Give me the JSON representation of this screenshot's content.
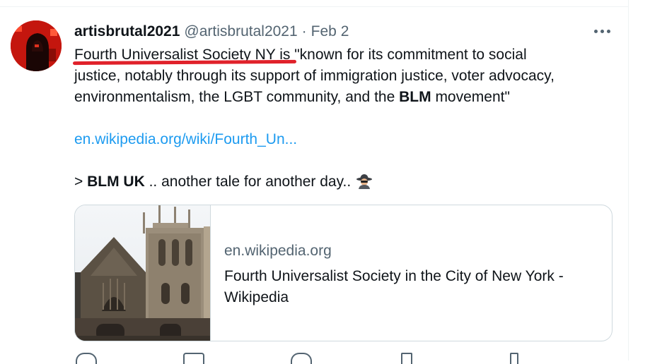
{
  "tweet": {
    "display_name": "artisbrutal2021",
    "handle": "@artisbrutal2021",
    "separator": "·",
    "date": "Feb 2",
    "body": {
      "line1_link": "Fourth Universalist Society NY",
      "line1_rest": " is \"known for its commitment to social",
      "line2": "justice, notably through its support of immigration justice, voter advocacy,",
      "line3_a": "environmentalism, the LGBT community, and the ",
      "line3_bold": "BLM",
      "line3_b": " movement\"",
      "url": "en.wikipedia.org/wiki/Fourth_Un...",
      "line6_prefix": "> ",
      "line6_bold": "BLM UK",
      "line6_rest": " .. another tale for another day.."
    }
  },
  "card": {
    "domain": "en.wikipedia.org",
    "title_line1": "Fourth Universalist Society in the City of New York -",
    "title_line2": "Wikipedia"
  },
  "colors": {
    "link": "#1d9bf0",
    "secondary_text": "#536471",
    "annotation_underline": "#e0212a",
    "avatar_bg": "#d11a10"
  },
  "icons": [
    "more-icon",
    "spy-emoji-icon",
    "reply-icon",
    "retweet-icon",
    "like-icon",
    "share-icon"
  ]
}
